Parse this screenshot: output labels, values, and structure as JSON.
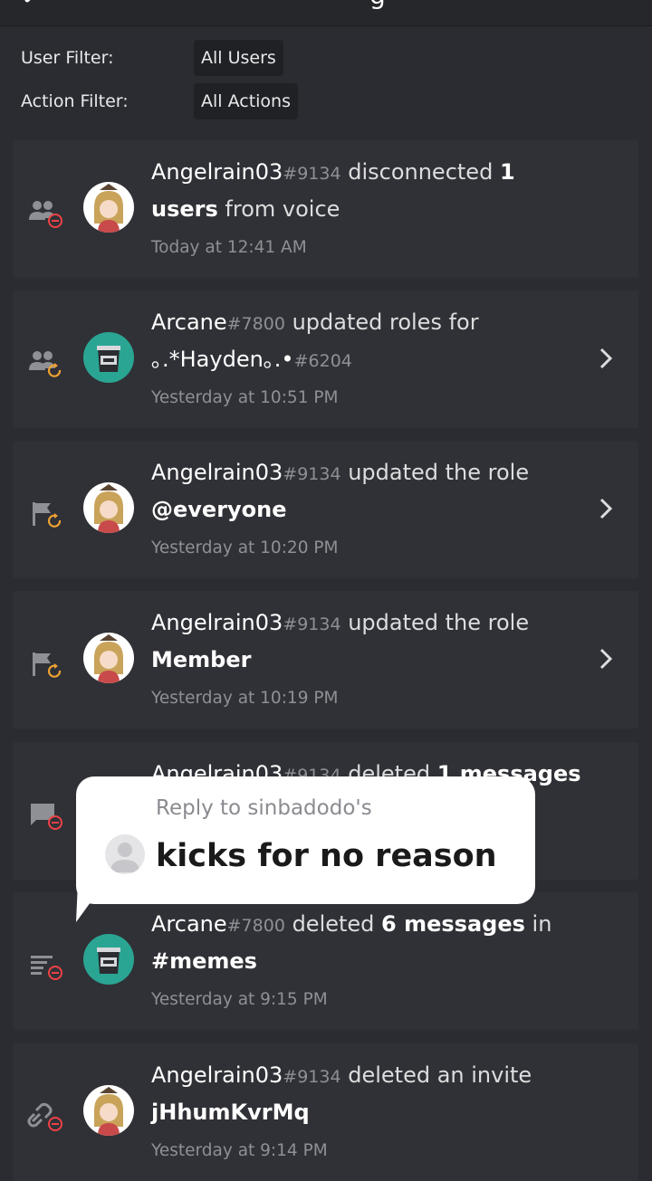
{
  "header": {
    "title_fragment": "g"
  },
  "filters": {
    "user_label": "User Filter:",
    "user_value": "All Users",
    "action_label": "Action Filter:",
    "action_value": "All Actions"
  },
  "entries": [
    {
      "icon": "member-disconnect-icon",
      "avatar": "anime-girl-avatar",
      "user": "Angelrain03",
      "disc": "#9134",
      "action": "disconnected",
      "target_bold": "1 users",
      "suffix": "from voice",
      "time": "Today at 12:41 AM",
      "has_chevron": false
    },
    {
      "icon": "member-role-update-icon",
      "avatar": "bot-bucket-avatar",
      "user": "Arcane",
      "disc": "#7800",
      "action": "updated roles for",
      "target": "｡.*Hayden｡.•",
      "target_disc": "#6204",
      "time": "Yesterday at 10:51 PM",
      "has_chevron": true
    },
    {
      "icon": "role-update-icon",
      "avatar": "anime-girl-avatar",
      "user": "Angelrain03",
      "disc": "#9134",
      "action": "updated the role",
      "target_bold": "@everyone",
      "time": "Yesterday at 10:20 PM",
      "has_chevron": true
    },
    {
      "icon": "role-update-icon",
      "avatar": "anime-girl-avatar",
      "user": "Angelrain03",
      "disc": "#9134",
      "action": "updated the role",
      "target_bold": "Member",
      "time": "Yesterday at 10:19 PM",
      "has_chevron": true
    },
    {
      "icon": "message-delete-icon",
      "avatar": "anime-girl-avatar",
      "user": "Angelrain03",
      "disc": "#9134",
      "action": "deleted",
      "target_bold": "1 messages",
      "time": "",
      "has_chevron": false
    },
    {
      "icon": "bulk-message-delete-icon",
      "avatar": "bot-bucket-avatar",
      "user": "Arcane",
      "disc": "#7800",
      "action": "deleted",
      "target_bold": "6 messages",
      "middle": "in",
      "channel_bold": "#memes",
      "time": "Yesterday at 9:15 PM",
      "has_chevron": false
    },
    {
      "icon": "invite-delete-icon",
      "avatar": "anime-girl-avatar",
      "user": "Angelrain03",
      "disc": "#9134",
      "action": "deleted an invite",
      "target_bold": "jHhumKvrMq",
      "time": "Yesterday at 9:14 PM",
      "has_chevron": false
    }
  ],
  "reply_bubble": {
    "reply_to": "Reply to sinbadodo's",
    "text": "kicks for no reason"
  },
  "colors": {
    "background": "#2b2c31",
    "card": "#303136",
    "chip": "#202125",
    "timestamp": "#8e9095",
    "status_orange": "#f0a232",
    "status_red": "#ed4245",
    "bot_teal": "#2aa593"
  }
}
